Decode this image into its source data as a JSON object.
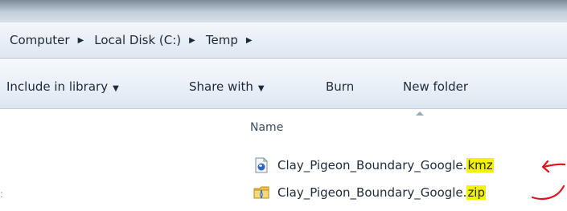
{
  "breadcrumb": {
    "items": [
      "Computer",
      "Local Disk (C:)",
      "Temp"
    ]
  },
  "toolbar": {
    "include_label": "Include in library",
    "share_label": "Share with",
    "burn_label": "Burn",
    "new_folder_label": "New folder"
  },
  "columns": {
    "name_label": "Name"
  },
  "files": [
    {
      "base": "Clay_Pigeon_Boundary_Google.",
      "ext": "kmz",
      "icon": "kmz-file-icon"
    },
    {
      "base": "Clay_Pigeon_Boundary_Google.",
      "ext": "zip",
      "icon": "zip-file-icon"
    }
  ],
  "colors": {
    "highlight": "#f4f200",
    "annotation": "#e0141e"
  }
}
